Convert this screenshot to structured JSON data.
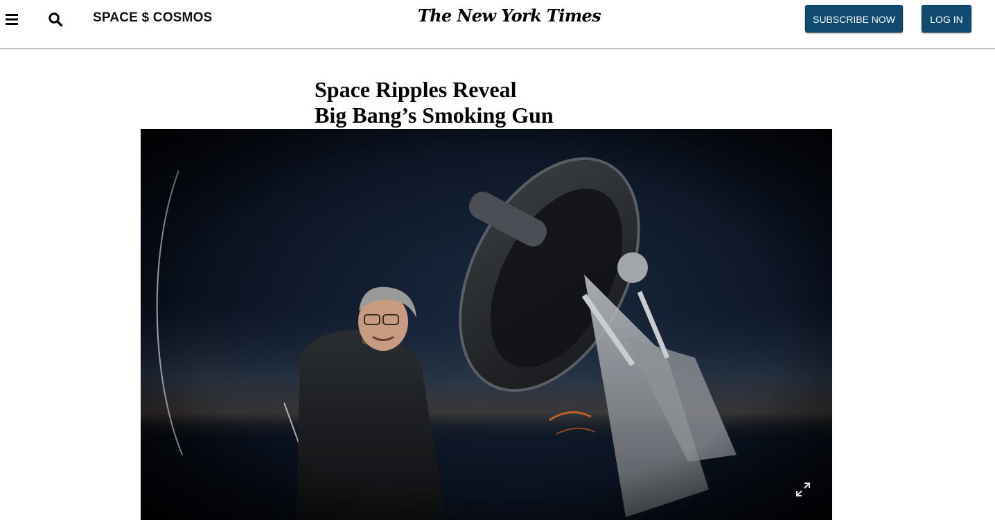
{
  "header": {
    "menu_icon": "hamburger-menu-icon",
    "search_icon": "search-icon",
    "section_name": "SPACE $ COSMOS",
    "logo": "The New York Times",
    "subscribe_label": "SUBSCRIBE NOW",
    "login_label": "LOG IN"
  },
  "article": {
    "headline_line1": "Space Ripples Reveal",
    "headline_line2": "Big Bang’s Smoking Gun"
  },
  "media": {
    "expand_icon": "expand-icon"
  },
  "colors": {
    "button_bg": "#104a6e",
    "divider": "#7a7a7a",
    "text": "#121212"
  }
}
